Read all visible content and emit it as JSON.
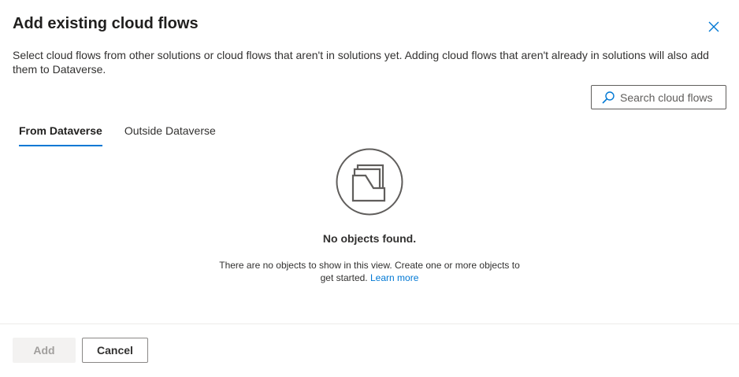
{
  "dialog": {
    "title": "Add existing cloud flows",
    "description": "Select cloud flows from other solutions or cloud flows that aren't in solutions yet. Adding cloud flows that aren't already in solutions will also add them to Dataverse.",
    "close_icon": "close-icon"
  },
  "search": {
    "placeholder": "Search cloud flows",
    "icon": "search-icon"
  },
  "tabs": [
    {
      "label": "From Dataverse",
      "active": true
    },
    {
      "label": "Outside Dataverse",
      "active": false
    }
  ],
  "empty_state": {
    "icon": "empty-folder-icon",
    "title": "No objects found.",
    "message": "There are no objects to show in this view. Create one or more objects to get started.",
    "link": "Learn more"
  },
  "footer": {
    "add_label": "Add",
    "cancel_label": "Cancel"
  },
  "colors": {
    "accent": "#0078d4",
    "text": "#323130",
    "disabled_bg": "#f3f2f1",
    "disabled_text": "#a19f9d",
    "border": "#8a8886"
  }
}
